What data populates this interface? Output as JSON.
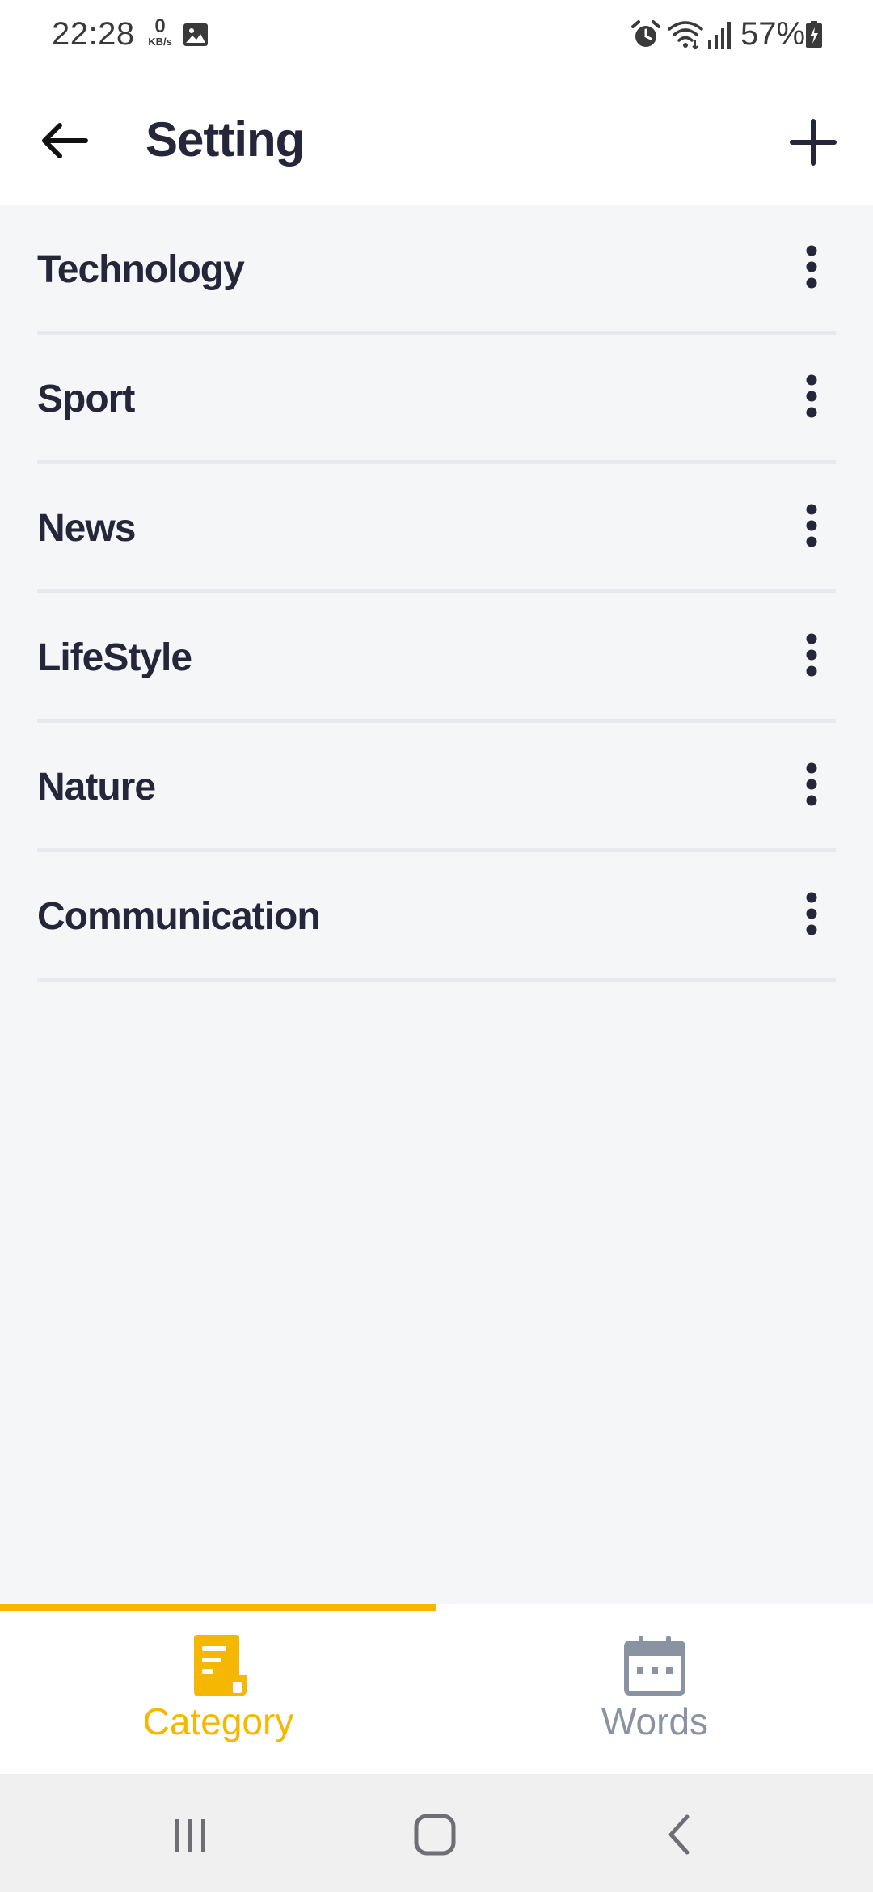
{
  "status_bar": {
    "time": "22:28",
    "net_speed_value": "0",
    "net_speed_unit": "KB/s",
    "battery_percent": "57%",
    "icons": [
      "image-icon",
      "alarm-icon",
      "wifi-icon",
      "signal-icon",
      "battery-charging-icon"
    ]
  },
  "app_bar": {
    "title": "Setting",
    "back_icon": "arrow-left-icon",
    "add_icon": "plus-icon"
  },
  "categories": [
    {
      "label": "Technology"
    },
    {
      "label": "Sport"
    },
    {
      "label": "News"
    },
    {
      "label": "LifeStyle"
    },
    {
      "label": "Nature"
    },
    {
      "label": "Communication"
    }
  ],
  "bottom_tabs": {
    "selected": "category",
    "items": [
      {
        "label": "Category",
        "icon": "document-icon",
        "active": true
      },
      {
        "label": "Words",
        "icon": "calendar-icon",
        "active": false
      }
    ]
  },
  "colors": {
    "accent": "#f6b700",
    "title_text": "#26263a",
    "inactive_tab": "#8a93a2",
    "background": "#f5f6f8",
    "divider": "#e8e9ed"
  },
  "system_nav": {
    "icons": [
      "recents-icon",
      "home-icon",
      "back-icon"
    ]
  }
}
